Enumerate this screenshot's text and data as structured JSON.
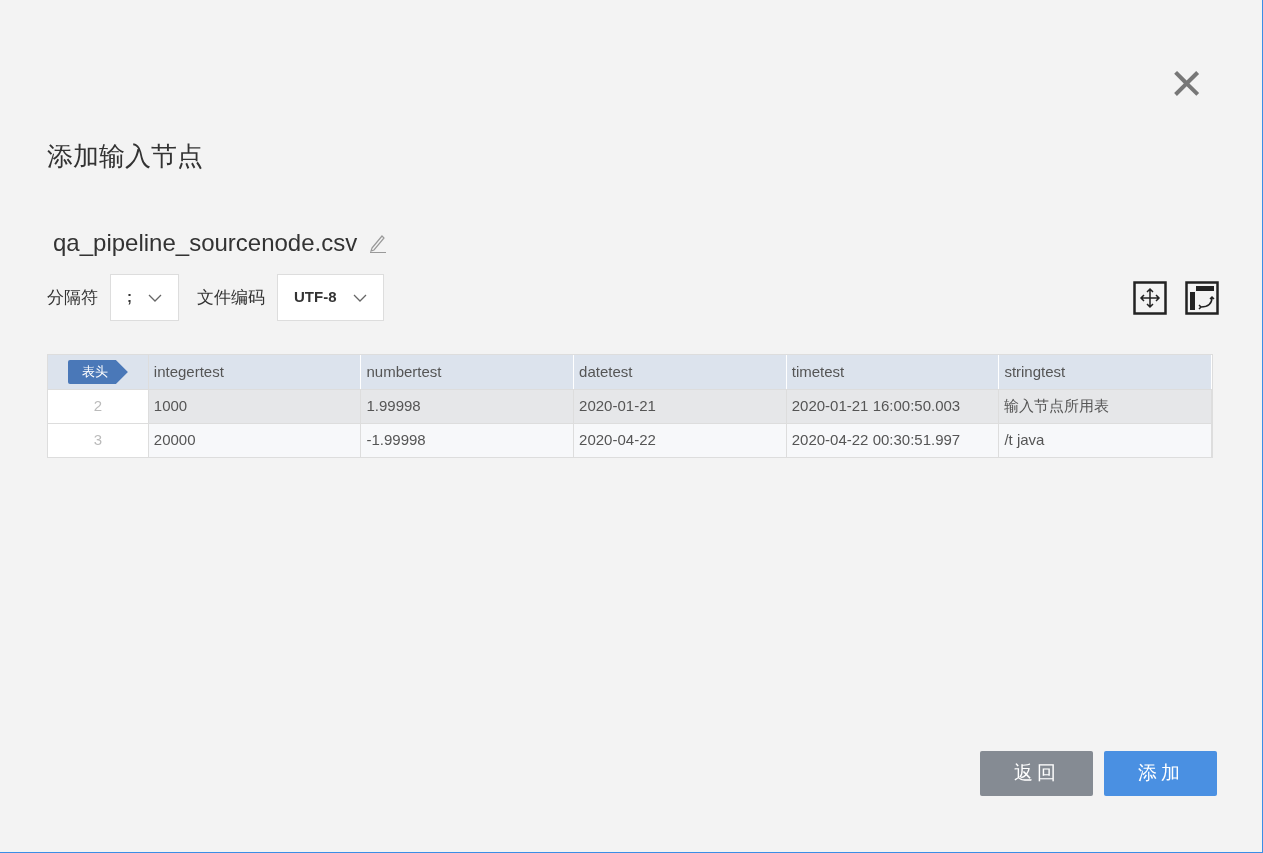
{
  "dialog": {
    "title": "添加输入节点",
    "close": "×"
  },
  "file": {
    "name": "qa_pipeline_sourcenode.csv"
  },
  "options": [
    {
      "label": "分隔符",
      "value": ";"
    },
    {
      "label": "文件编码",
      "value": "UTF-8"
    }
  ],
  "table": {
    "header_badge": "表头",
    "columns": [
      "integertest",
      "numbertest",
      "datetest",
      "timetest",
      "stringtest"
    ],
    "rows": [
      {
        "index": "2",
        "selected": true,
        "cells": [
          "1000",
          "1.99998",
          "2020-01-21",
          "2020-01-21 16:00:50.003",
          "输入节点所用表"
        ]
      },
      {
        "index": "3",
        "selected": false,
        "cells": [
          "20000",
          "-1.99998",
          "2020-04-22",
          "2020-04-22 00:30:51.997",
          "/t java"
        ]
      }
    ]
  },
  "buttons": [
    {
      "label": "返回",
      "kind": "secondary"
    },
    {
      "label": "添加",
      "kind": "primary"
    }
  ]
}
